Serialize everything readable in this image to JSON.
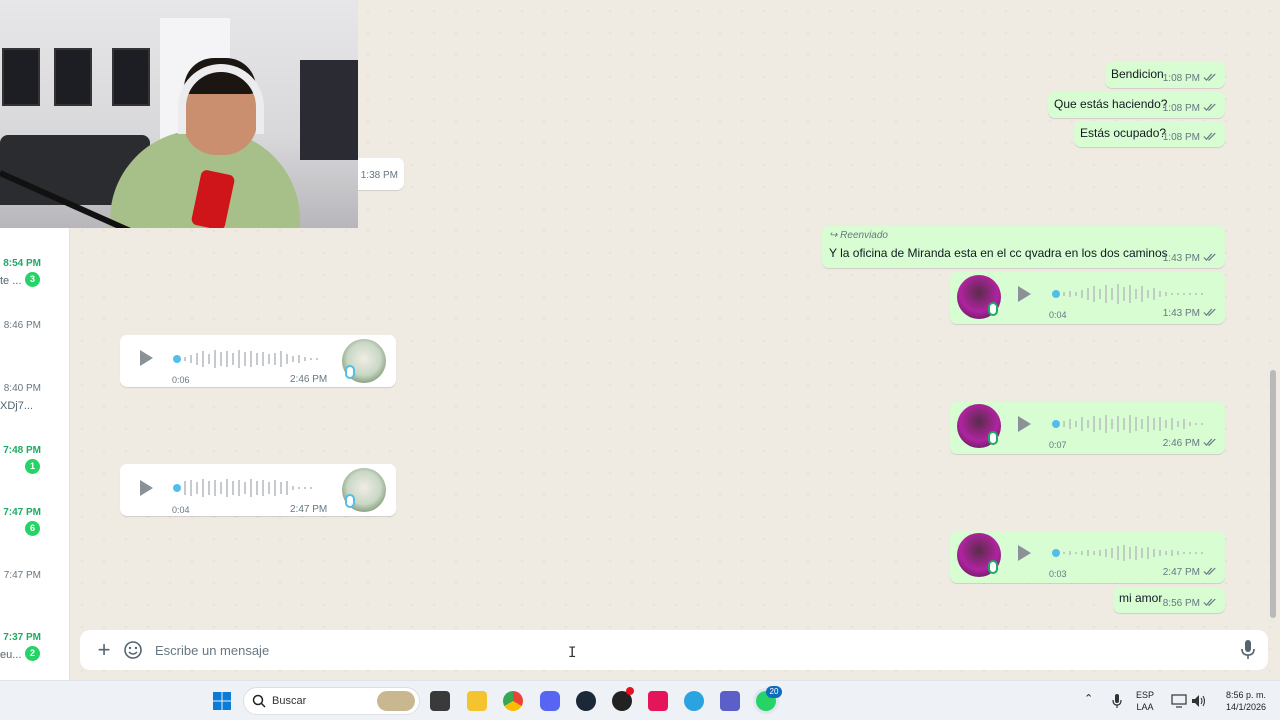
{
  "chat_list": {
    "items": [
      {
        "time": "8:54 PM",
        "snippet": "te ...",
        "badge": "3",
        "unread": true
      },
      {
        "time": "8:46 PM",
        "snippet": "",
        "badge": "",
        "unread": false
      },
      {
        "time": "8:40 PM",
        "snippet": "XDj7...",
        "badge": "",
        "unread": false
      },
      {
        "time": "7:48 PM",
        "snippet": "",
        "badge": "1",
        "unread": true
      },
      {
        "time": "7:47 PM",
        "snippet": "",
        "badge": "6",
        "unread": true
      },
      {
        "time": "7:47 PM",
        "snippet": "",
        "badge": "",
        "unread": false
      },
      {
        "time": "7:37 PM",
        "snippet": "eu...",
        "badge": "2",
        "unread": true
      }
    ]
  },
  "messages": {
    "m1": {
      "text": "Bendicion",
      "time": "1:08 PM"
    },
    "m2": {
      "text": "Que estás haciendo?",
      "time": "1:08 PM"
    },
    "m3": {
      "text": "Estás ocupado?",
      "time": "1:08 PM"
    },
    "partial_time": "1:38 PM",
    "m4": {
      "forward_label": "Reenviado",
      "text": "Y la oficina de Miranda esta en el cc qvadra  en los dos caminos",
      "time": "1:43 PM"
    },
    "v1": {
      "duration": "0:04",
      "time": "1:43 PM"
    },
    "v2": {
      "duration": "0:06",
      "time": "2:46 PM"
    },
    "v3": {
      "duration": "0:07",
      "time": "2:46 PM"
    },
    "v4": {
      "duration": "0:04",
      "time": "2:47 PM"
    },
    "v5": {
      "duration": "0:03",
      "time": "2:47 PM"
    },
    "m5": {
      "text": "mi amor",
      "time": "8:56 PM"
    }
  },
  "composer": {
    "placeholder": "Escribe un mensaje",
    "plus_icon": "plus-icon",
    "emoji_icon": "sticker-emoji-icon",
    "mic_icon": "microphone-icon"
  },
  "taskbar": {
    "search_placeholder": "Buscar",
    "whatsapp_badge": "20",
    "lang_top": "ESP",
    "lang_bottom": "LAA",
    "clock_time": "8:56 p. m.",
    "clock_date": "14/1/2026",
    "pinned": [
      "windows-start-icon",
      "search-icon",
      "task-view-icon",
      "file-explorer-icon",
      "chrome-icon",
      "discord-icon",
      "steam-icon",
      "game-icon",
      "tiktok-icon",
      "telegram-icon",
      "teams-icon",
      "whatsapp-icon"
    ]
  },
  "colors": {
    "outgoing_bubble": "#d9fdd3",
    "incoming_bubble": "#ffffff",
    "unread_green": "#25d366",
    "read_tick": "#53bdeb"
  }
}
